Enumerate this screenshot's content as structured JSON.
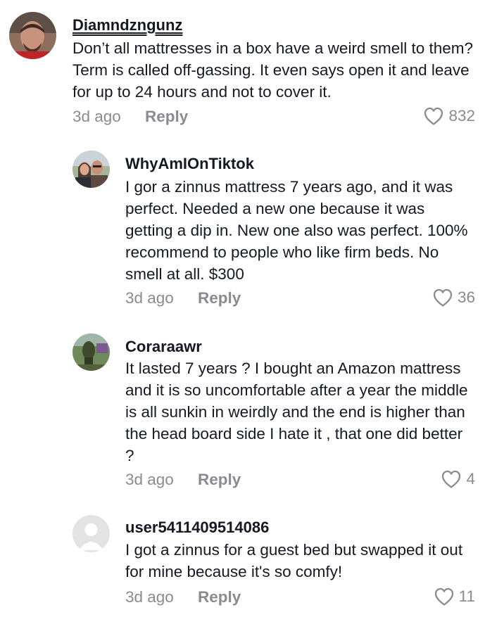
{
  "comments": [
    {
      "username": "Diamndzngunz",
      "text": "Don’t all mattresses in a box have a weird smell to them? Term is called off-gassing. It even says open it and leave for up to 24 hours and not to cover it.",
      "time": "3d ago",
      "reply_label": "Reply",
      "likes": "832",
      "icon": "heart-outline-icon"
    },
    {
      "username": "WhyAmIOnTiktok",
      "text": "I gor a zinnus mattress 7 years ago, and it was perfect. Needed a new one because it was getting a dip in. New one also was perfect. 100% recommend to people who like firm beds. No smell at all. $300",
      "time": "3d ago",
      "reply_label": "Reply",
      "likes": "36",
      "icon": "heart-outline-icon"
    },
    {
      "username": "Coraraawr",
      "text": "It lasted 7 years ? I bought an Amazon mattress and it is so uncomfortable after a year the middle is all sunkin in weirdly and the end is higher than the head board side I hate it , that one did better ?",
      "time": "3d ago",
      "reply_label": "Reply",
      "likes": "4",
      "icon": "heart-outline-icon"
    },
    {
      "username": "user5411409514086",
      "text": "I got a zinnus for a guest bed but swapped it out for mine because it's so comfy!",
      "time": "3d ago",
      "reply_label": "Reply",
      "likes": "11",
      "icon": "heart-outline-icon"
    }
  ]
}
